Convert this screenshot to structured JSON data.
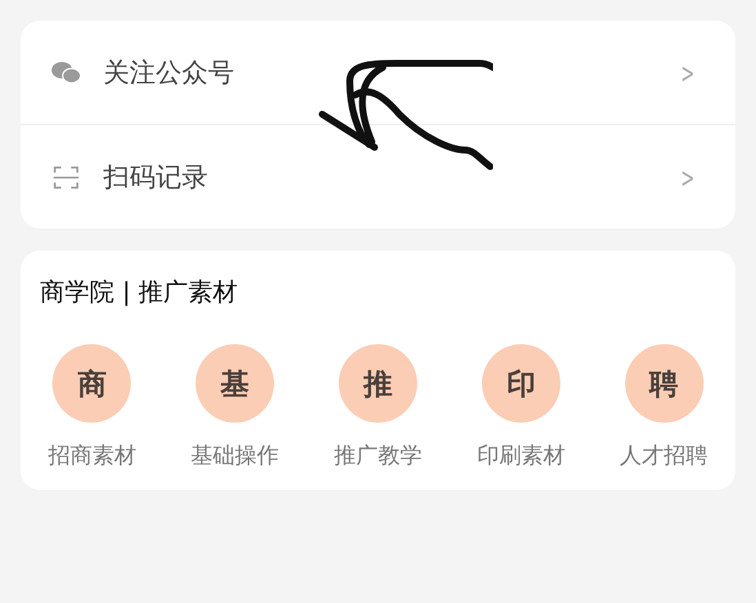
{
  "menu": [
    {
      "kind": "wechat",
      "label": "关注公众号",
      "chevron": ">"
    },
    {
      "kind": "scan",
      "label": "扫码记录",
      "chevron": ">"
    }
  ],
  "academy": {
    "title": "商学院 | 推广素材",
    "items": [
      {
        "badge": "商",
        "label": "招商素材"
      },
      {
        "badge": "基",
        "label": "基础操作"
      },
      {
        "badge": "推",
        "label": "推广教学"
      },
      {
        "badge": "印",
        "label": "印刷素材"
      },
      {
        "badge": "聘",
        "label": "人才招聘"
      }
    ]
  }
}
